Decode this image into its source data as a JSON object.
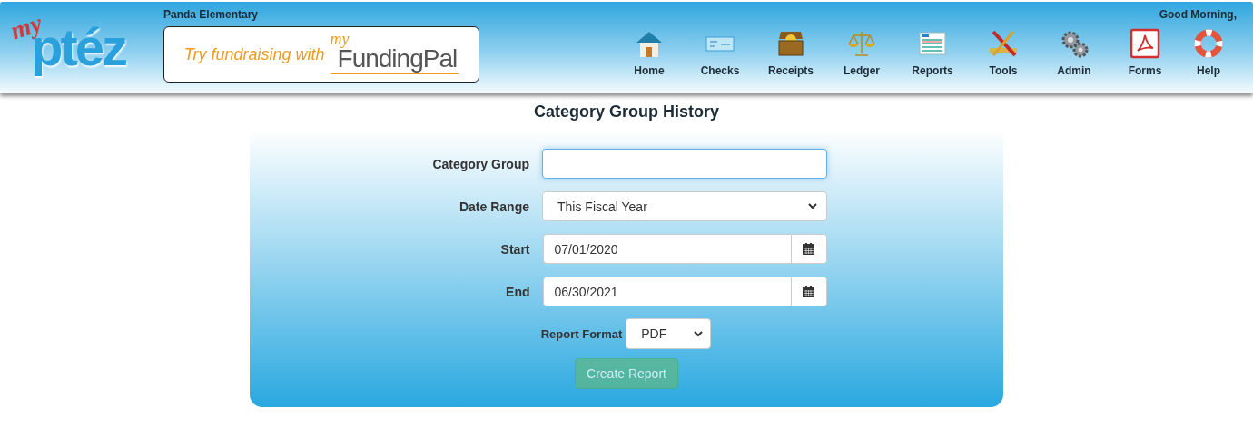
{
  "header": {
    "logo": {
      "small": "my",
      "main": "ptéz"
    },
    "school": "Panda Elementary",
    "greeting": "Good Morning,",
    "banner": {
      "text": "Try fundraising with",
      "brand_small": "my",
      "brand": "FundingPal"
    },
    "nav": [
      {
        "label": "Home",
        "kind": "house"
      },
      {
        "label": "Checks",
        "kind": "check"
      },
      {
        "label": "Receipts",
        "kind": "chest"
      },
      {
        "label": "Ledger",
        "kind": "scale"
      },
      {
        "label": "Reports",
        "kind": "report"
      },
      {
        "label": "Tools",
        "kind": "tools"
      },
      {
        "label": "Admin",
        "kind": "gears"
      },
      {
        "label": "Forms",
        "kind": "pdf"
      },
      {
        "label": "Help",
        "kind": "lifebuoy"
      }
    ]
  },
  "title": "Category Group History",
  "form": {
    "fields": [
      {
        "label": "Category Group",
        "kind": "text",
        "focused": true
      },
      {
        "label": "Date Range",
        "kind": "select",
        "value": "This Fiscal Year"
      },
      {
        "label": "Start",
        "kind": "date",
        "value": "07/01/2020"
      },
      {
        "label": "End",
        "kind": "date",
        "value": "06/30/2021"
      }
    ],
    "format": {
      "label": "Report Format",
      "value": "PDF"
    },
    "submit": {
      "label": "Create Report",
      "disabled": true
    }
  }
}
